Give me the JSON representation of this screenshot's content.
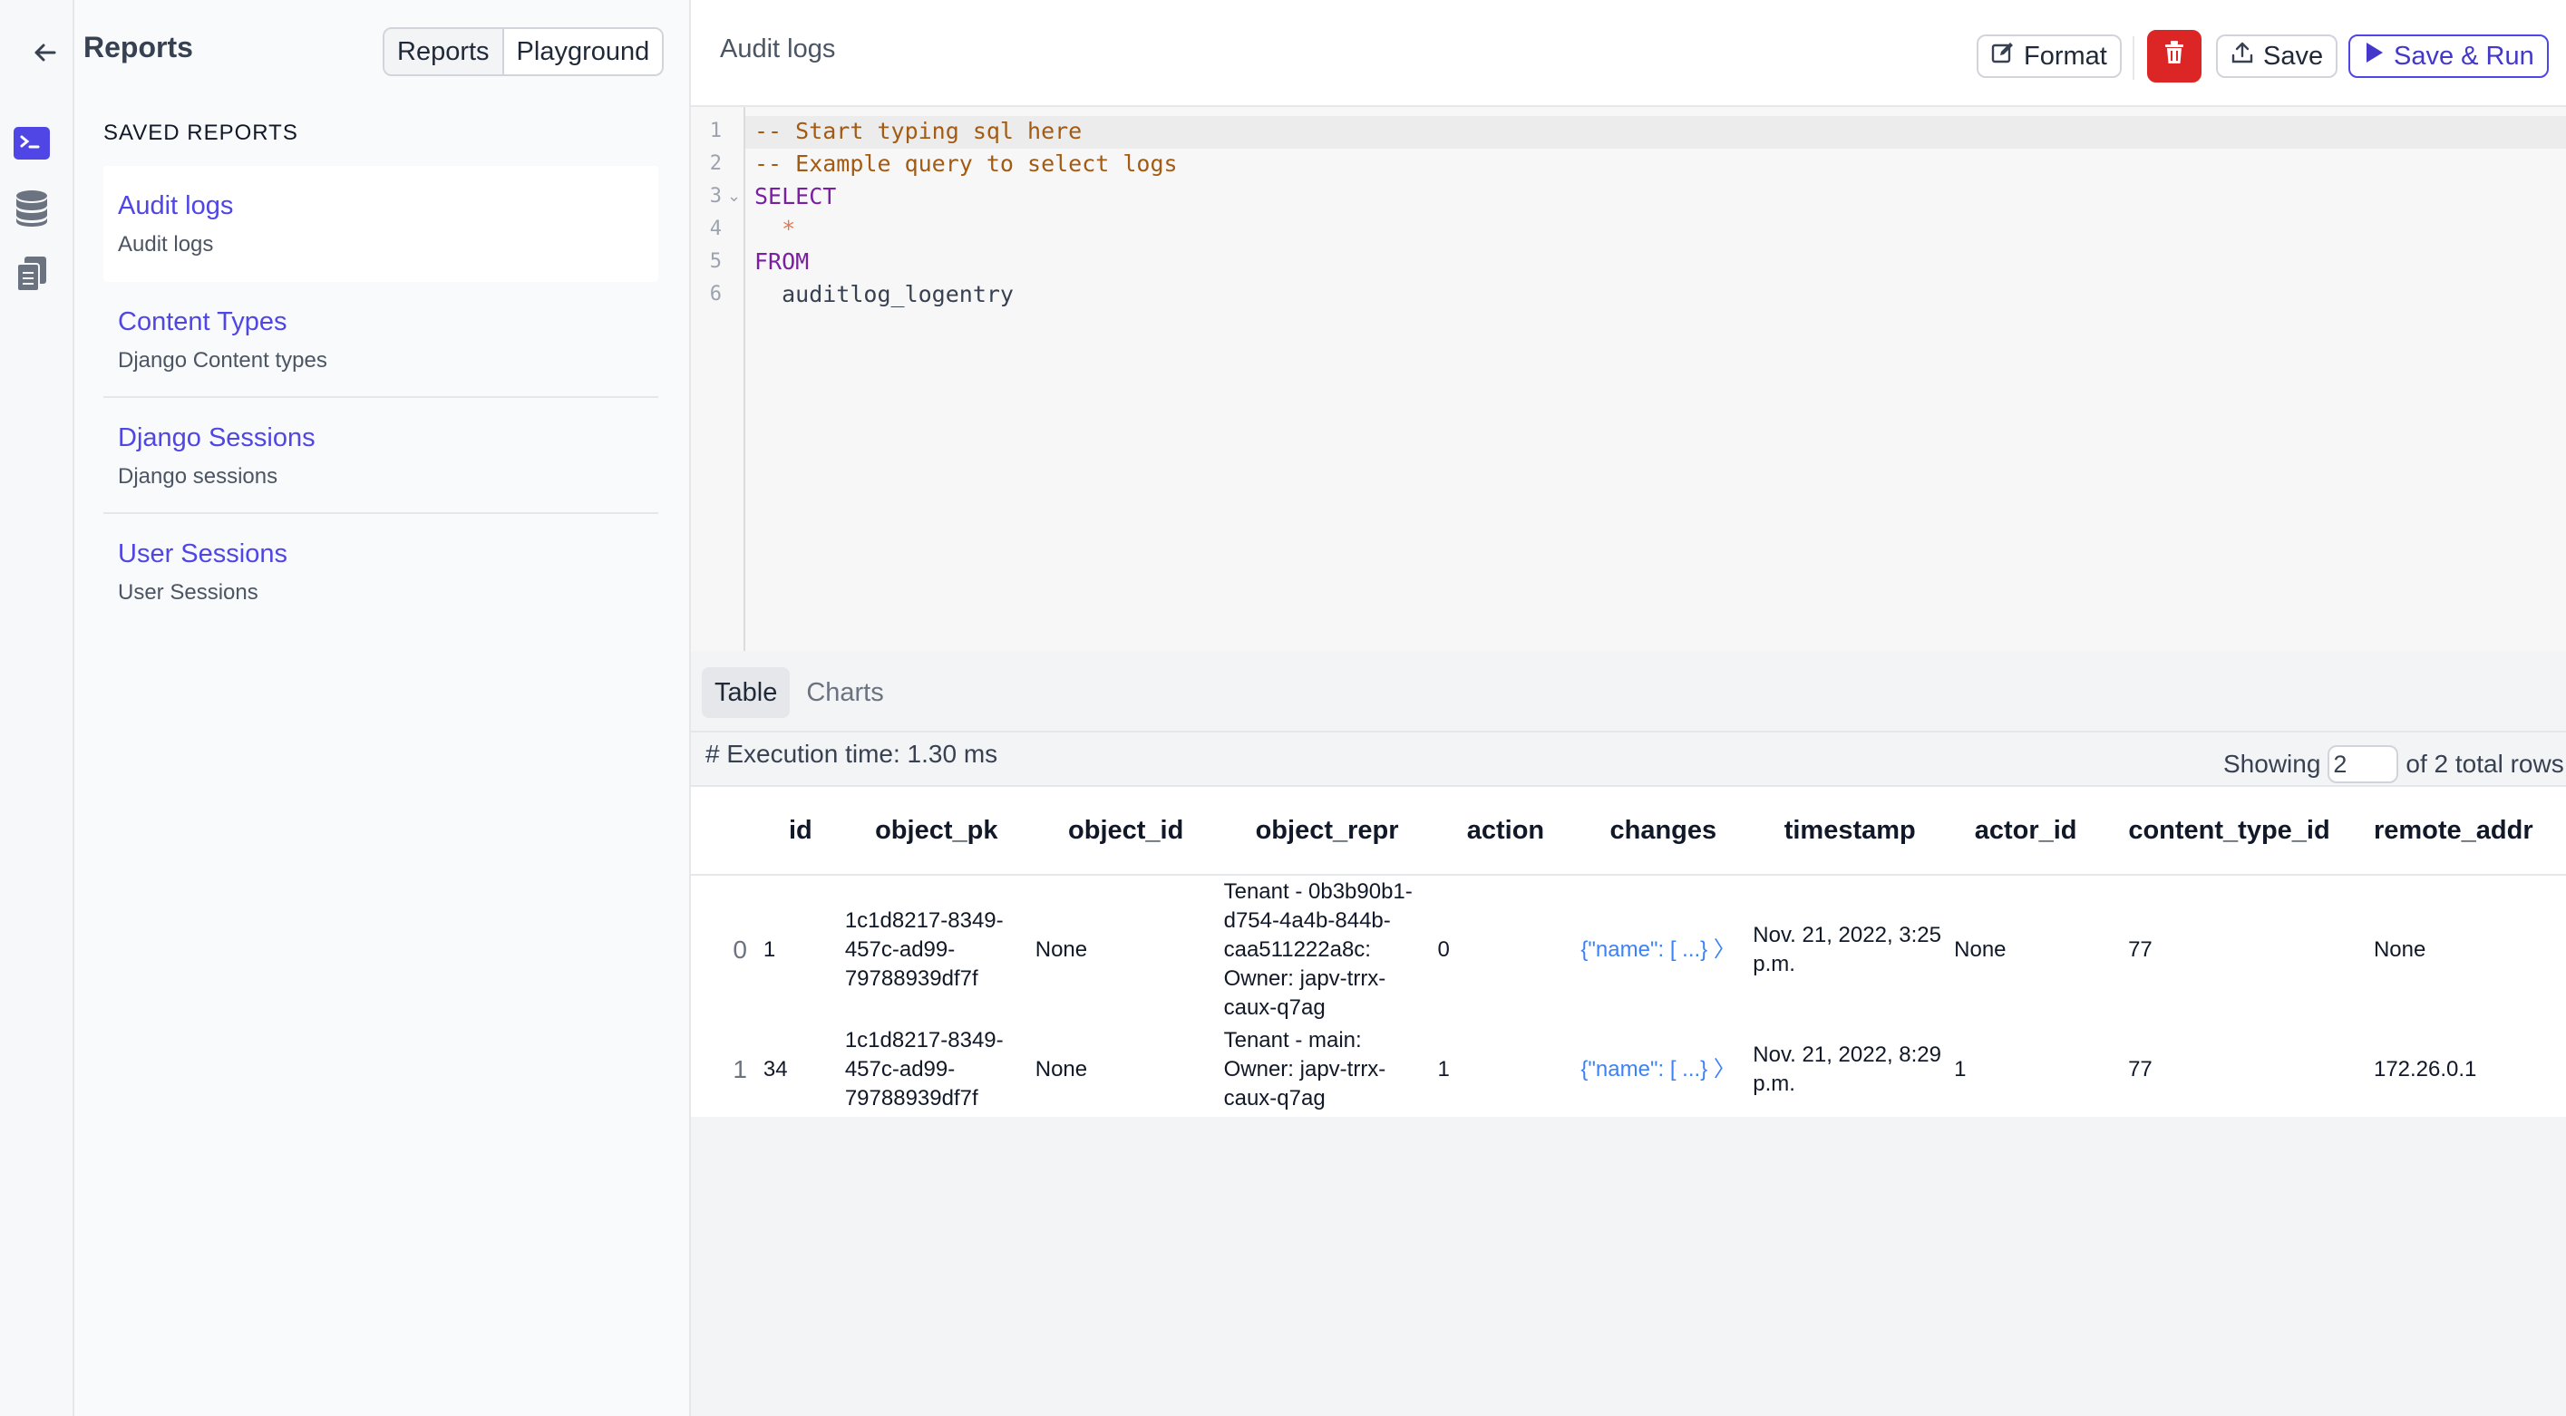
{
  "sidebar": {
    "title": "Reports",
    "segments": [
      "Reports",
      "Playground"
    ],
    "saved_heading": "SAVED REPORTS",
    "reports": [
      {
        "name": "Audit logs",
        "desc": "Audit logs"
      },
      {
        "name": "Content Types",
        "desc": "Django Content types"
      },
      {
        "name": "Django Sessions",
        "desc": "Django sessions"
      },
      {
        "name": "User Sessions",
        "desc": "User Sessions"
      }
    ]
  },
  "header": {
    "title": "Audit logs",
    "format_label": "Format",
    "save_label": "Save",
    "run_label": "Save & Run"
  },
  "editor": {
    "lines": [
      "1",
      "2",
      "3",
      "4",
      "5",
      "6"
    ],
    "code": {
      "l1": "-- Start typing sql here",
      "l2": "-- Example query to select logs",
      "l3": "SELECT",
      "l4": "  *",
      "l5": "FROM",
      "l6": "  auditlog_logentry"
    }
  },
  "results": {
    "tabs": [
      "Table",
      "Charts"
    ],
    "exec_time": "# Execution time: 1.30 ms",
    "showing_label": "Showing",
    "showing_value": "2",
    "total_label": "of 2 total rows",
    "columns": [
      "",
      "id",
      "object_pk",
      "object_id",
      "object_repr",
      "action",
      "changes",
      "timestamp",
      "actor_id",
      "content_type_id",
      "remote_addr"
    ],
    "rows": [
      {
        "idx": "0",
        "id": "1",
        "object_pk": "1c1d8217-8349-457c-ad99-79788939df7f",
        "object_id": "None",
        "object_repr": "Tenant - 0b3b90b1-d754-4a4b-844b-caa511222a8c: Owner: japv-trrx-caux-q7ag",
        "action": "0",
        "changes": "{\"name\": [ ...} 〉",
        "timestamp": "Nov. 21, 2022, 3:25 p.m.",
        "actor_id": "None",
        "content_type_id": "77",
        "remote_addr": "None"
      },
      {
        "idx": "1",
        "id": "34",
        "object_pk": "1c1d8217-8349-457c-ad99-79788939df7f",
        "object_id": "None",
        "object_repr": "Tenant - main: Owner: japv-trrx-caux-q7ag",
        "action": "1",
        "changes": "{\"name\": [ ...} 〉",
        "timestamp": "Nov. 21, 2022, 8:29 p.m.",
        "actor_id": "1",
        "content_type_id": "77",
        "remote_addr": "172.26.0.1"
      }
    ]
  },
  "colors": {
    "accent": "#4f46e5",
    "danger": "#dc2626",
    "link": "#3b82f6"
  },
  "icons": [
    "terminal-icon",
    "database-icon",
    "clipboard-icon",
    "arrow-left-icon",
    "edit-icon",
    "trash-icon",
    "upload-icon",
    "play-icon"
  ]
}
